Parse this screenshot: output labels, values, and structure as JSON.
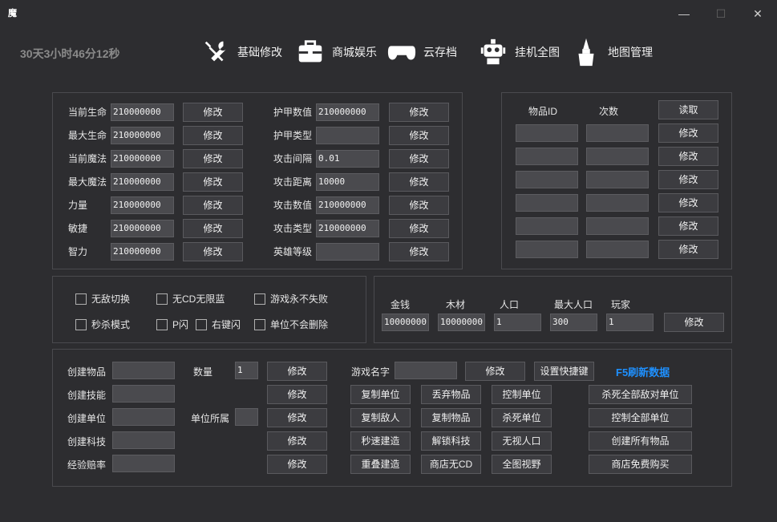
{
  "window": {
    "title_glyph": "魔",
    "controls": {
      "minimize": "—",
      "maximize": "☐",
      "close": "✕"
    }
  },
  "timer": "30天3小时46分12秒",
  "nav": [
    {
      "label": "基础修改",
      "icon": "tools-icon"
    },
    {
      "label": "商城娱乐",
      "icon": "briefcase-icon"
    },
    {
      "label": "云存档",
      "icon": "gamepad-icon"
    },
    {
      "label": "挂机全图",
      "icon": "robot-icon"
    },
    {
      "label": "地图管理",
      "icon": "brush-icon"
    }
  ],
  "stats_left": [
    {
      "label": "当前生命",
      "value": "210000000",
      "button": "修改"
    },
    {
      "label": "最大生命",
      "value": "210000000",
      "button": "修改"
    },
    {
      "label": "当前魔法",
      "value": "210000000",
      "button": "修改"
    },
    {
      "label": "最大魔法",
      "value": "210000000",
      "button": "修改"
    },
    {
      "label": "力量",
      "value": "210000000",
      "button": "修改"
    },
    {
      "label": "敏捷",
      "value": "210000000",
      "button": "修改"
    },
    {
      "label": "智力",
      "value": "210000000",
      "button": "修改"
    }
  ],
  "stats_right": [
    {
      "label": "护甲数值",
      "value": "210000000",
      "button": "修改"
    },
    {
      "label": "护甲类型",
      "value": "",
      "button": "修改"
    },
    {
      "label": "攻击间隔",
      "value": "0.01",
      "button": "修改"
    },
    {
      "label": "攻击距离",
      "value": "10000",
      "button": "修改"
    },
    {
      "label": "攻击数值",
      "value": "210000000",
      "button": "修改"
    },
    {
      "label": "攻击类型",
      "value": "210000000",
      "button": "修改"
    },
    {
      "label": "英雄等级",
      "value": "",
      "button": "修改"
    }
  ],
  "items": {
    "header_id": "物品ID",
    "header_count": "次数",
    "read_button": "读取",
    "rows": [
      {
        "id": "",
        "count": "",
        "button": "修改"
      },
      {
        "id": "",
        "count": "",
        "button": "修改"
      },
      {
        "id": "",
        "count": "",
        "button": "修改"
      },
      {
        "id": "",
        "count": "",
        "button": "修改"
      },
      {
        "id": "",
        "count": "",
        "button": "修改"
      },
      {
        "id": "",
        "count": "",
        "button": "修改"
      }
    ]
  },
  "toggles": {
    "invincible": "无敌切换",
    "no_cd": "无CD无限蓝",
    "never_lose": "游戏永不失败",
    "instakill": "秒杀模式",
    "p_flash": "P闪",
    "rclick_flash": "右键闪",
    "unit_no_delete": "单位不会删除"
  },
  "resources": {
    "gold_label": "金钱",
    "gold": "10000000",
    "wood_label": "木材",
    "wood": "10000000",
    "pop_label": "人口",
    "pop": "1",
    "maxpop_label": "最大人口",
    "maxpop": "300",
    "player_label": "玩家",
    "player": "1",
    "button": "修改"
  },
  "create": {
    "rows": [
      {
        "label": "创建物品",
        "value": "",
        "button": "修改"
      },
      {
        "label": "创建技能",
        "value": "",
        "button": "修改"
      },
      {
        "label": "创建单位",
        "value": "",
        "button": "修改"
      },
      {
        "label": "创建科技",
        "value": "",
        "button": "修改"
      },
      {
        "label": "经验赔率",
        "value": "",
        "button": "修改"
      }
    ],
    "qty_label": "数量",
    "qty_value": "1",
    "owner_label": "单位所属",
    "owner_value": ""
  },
  "actions": {
    "game_name_label": "游戏名字",
    "game_name_value": "",
    "game_name_button": "修改",
    "hotkey_button": "设置快捷键",
    "refresh_text": "F5刷新数据",
    "grid": [
      [
        "复制单位",
        "丢弃物品",
        "控制单位",
        "杀死全部敌对单位"
      ],
      [
        "复制敌人",
        "复制物品",
        "杀死单位",
        "控制全部单位"
      ],
      [
        "秒速建造",
        "解锁科技",
        "无视人口",
        "创建所有物品"
      ],
      [
        "重叠建造",
        "商店无CD",
        "全图视野",
        "商店免费购买"
      ]
    ]
  }
}
